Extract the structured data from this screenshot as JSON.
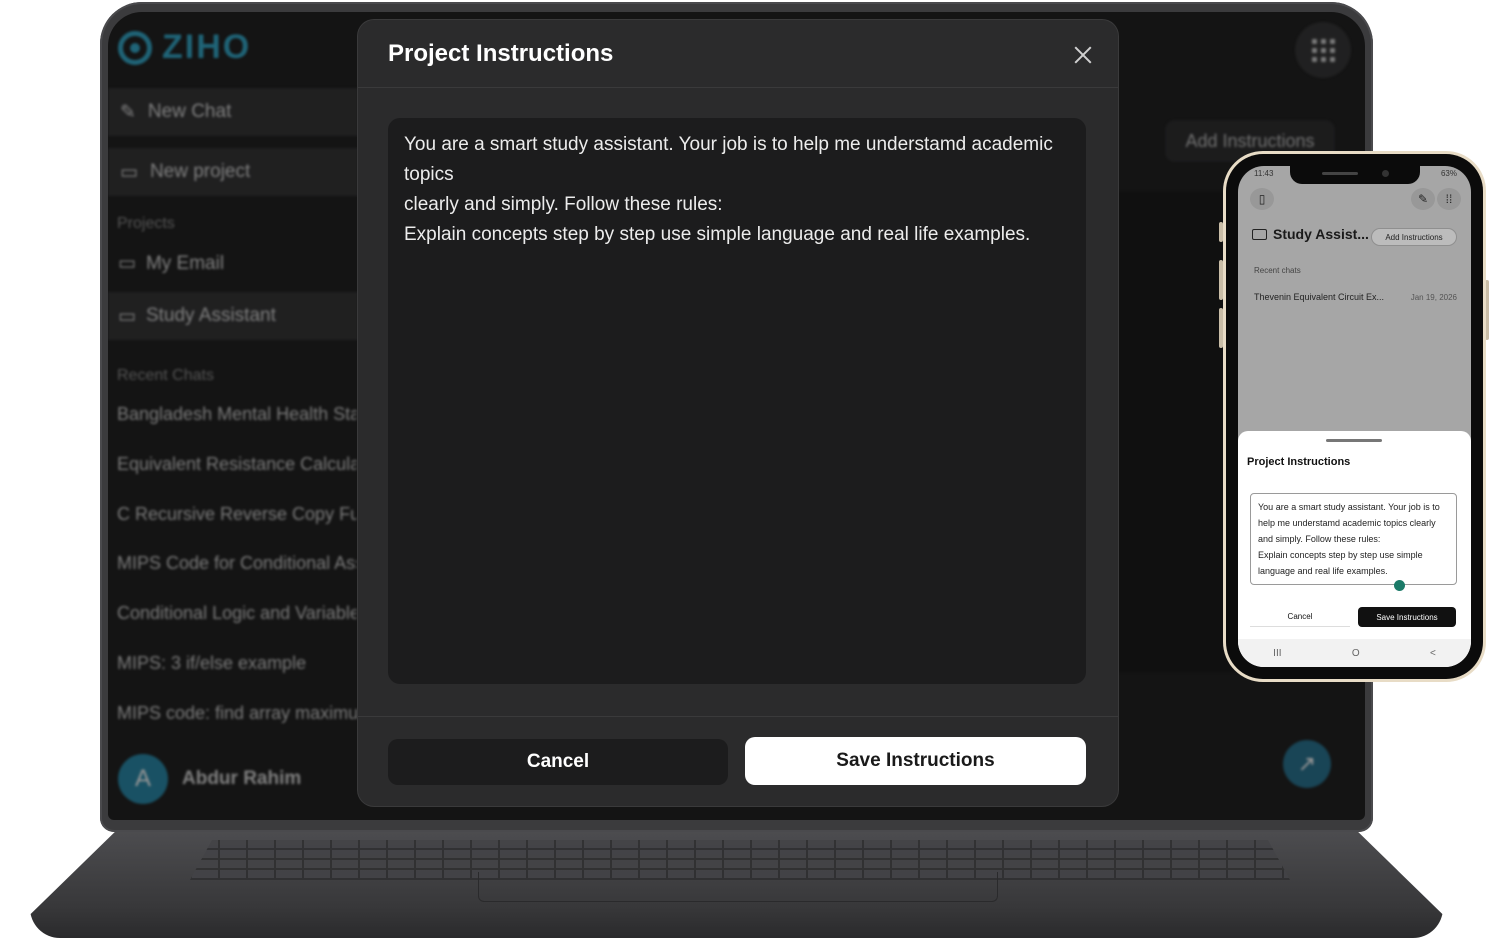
{
  "desktop": {
    "brand": "ZIHO",
    "sidebar": {
      "new_chat": "New Chat",
      "new_project": "New project",
      "projects_label": "Projects",
      "projects": [
        "My Email",
        "Study Assistant"
      ],
      "recent_label": "Recent Chats",
      "recent_chats": [
        "Bangladesh Mental Health Stat",
        "Equivalent Resistance Calculati",
        "C Recursive Reverse Copy Func",
        "MIPS Code for Conditional Ass",
        "Conditional Logic and Variable",
        "MIPS: 3 if/else example",
        "MIPS code: find array maximum"
      ],
      "user_initial": "A",
      "user_name": "Abdur Rahim"
    },
    "add_instructions": "Add Instructions",
    "modal": {
      "title": "Project Instructions",
      "instructions": "You are a smart study assistant. Your job is to help me understamd academic topics\nclearly and simply. Follow these rules:\nExplain concepts step by step use simple language and real life examples.",
      "cancel": "Cancel",
      "save": "Save Instructions"
    }
  },
  "phone": {
    "status_time": "11:43",
    "status_battery": "63%",
    "project_title": "Study Assist...",
    "add_instructions": "Add Instructions",
    "recent_label": "Recent chats",
    "chat_title": "Thevenin Equivalent Circuit Ex...",
    "chat_date": "Jan 19, 2026",
    "sheet_title": "Project Instructions",
    "instructions": "You are a smart study assistant. Your job is to help me understamd academic topics clearly and simply. Follow these rules:\nExplain concepts step by step use simple language and real life examples.",
    "cancel": "Cancel",
    "save": "Save Instructions",
    "nav": [
      "III",
      "O",
      "<"
    ]
  }
}
